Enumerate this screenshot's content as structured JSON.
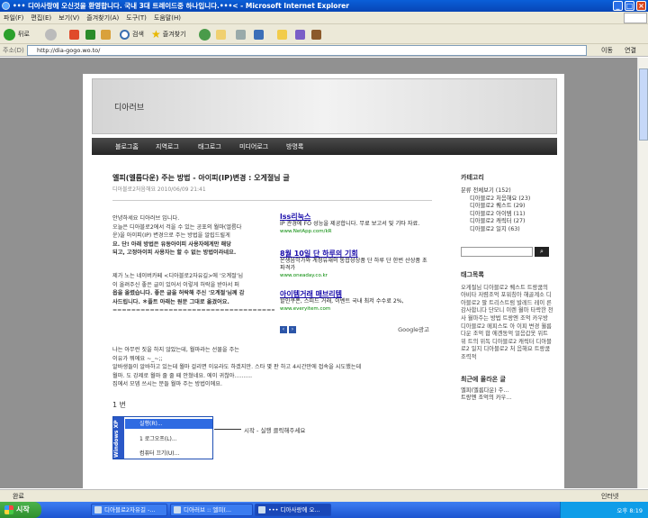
{
  "window": {
    "title": "••• 디아사랑에 오신것을 환영합니다. 국내 3대 트레이드중 하나입니다.•••< - Microsoft Internet Explorer",
    "controls": {
      "minimize": "_",
      "maximize": "□",
      "close": "×"
    }
  },
  "menu": [
    "파일(F)",
    "편집(E)",
    "보기(V)",
    "즐겨찾기(A)",
    "도구(T)",
    "도움말(H)"
  ],
  "toolbar": {
    "back": "뒤로",
    "search": "검색",
    "favorites": "즐겨찾기"
  },
  "address": {
    "label": "주소(D)",
    "url": "http://dia-gogo.wo.to/",
    "go": "이동",
    "links": "연결"
  },
  "blog": {
    "site_title": "디아러브",
    "nav": [
      "블로그홈",
      "지역로그",
      "태그로그",
      "미디어로그",
      "방명록"
    ],
    "post": {
      "title": "엘피(엘름다운) 주는 방법 - 아이피(IP)변경 : 오게절님 글",
      "meta": "디아블로2처음해요    2010/06/09 21:41",
      "intro": [
        "안녕하세요 디아러브 입니다.",
        "오늘은 디아블로2에서 걱을 수 있는 공포의 월마(엘름다",
        "운)을 아이피(IP) 변경으로 주는 방법을 알립드릴게",
        "요. 단! 아래 방법은 유동아이피 사용자에게만 해당",
        "되고, 고정아이피 사용자는 할 수 없는 방법이라네요."
      ],
      "intro2": [
        "제가 노는 네이버카페 <디아블로2자유길>에 '오계절'님",
        "이 올려주신 좋은 글이 있어서 이렇게 허락을 받아서 퍼",
        "옵을 올렸습니다. 좋은 글을 허락해 주신 '오계절'님께 감",
        "사드립니다. ＊플트 아래는 원문 그대로 옮겼어요.",
        "==========================================="
      ],
      "body": [
        "나는 아무런 짓을 하지 않았는데, 월마라는 선물을 주는",
        "이유가 뭐에요 ~_~;;",
        "알바생들이 알바하고 있는데 월마 걸리면 이유라도 하겠지만. 스타 몇 판 하고 4시간만에 접속을 시도했는데",
        "월마. 도 강제로 월마 줄 줄 떼 안쳤네요. 에이 귀찮아..........",
        "",
        "집에서 모뎀 쓰시는 분들 월마 주는 방법이에요."
      ],
      "step": "1 번",
      "start_menu": {
        "brand": "Windows XP",
        "items": [
          "실행(R)...",
          "1 로그오프(L)...",
          "컴퓨터 끄기(U)..."
        ]
      },
      "callout": "시작 - 실행 클릭해주세요"
    },
    "ads": [
      {
        "title": "lss리눅스",
        "desc": "IP 관경에 FO 성능을 제공합니다. 무료 보고서 및 기타 자료.",
        "url": "www.NetApp.com/kR"
      },
      {
        "title": "8월 10일 단 하루의 기회",
        "desc": "온생음악가와 계정유재의 통합성상품 단 하루 단 한번 산상품 초 파격가",
        "url": "www.oneaday.co.kr"
      },
      {
        "title": "아이템거래 매브리템",
        "desc": "할인쿠폰, 스피드 거래, 이벤트 국내 최저 수수료 2%,",
        "url": "www.everyitem.com"
      }
    ],
    "google_ad_label": "Google광고",
    "sidebar": {
      "category_heading": "카테고리",
      "category_root": "분류 전체보기 (152)",
      "categories": [
        "디아블로2 처음해요 (23)",
        "디아블로2 퀘스트 (29)",
        "디아블로2 아이템 (11)",
        "디아블로2 캐릭터 (27)",
        "디아블로2 일지 (63)"
      ],
      "search_button": "검색",
      "tag_heading": "태그목록",
      "tags": "오게절님  디아블로2 퀘스트  트랑쿰의 아비타  저렴조억 포워칭아 해골계소  디아블로2 팔  트리스트럼  발레드 레이 른 감사합니다  단모니 이렌 월마  타락한 천사  월마주는 방법  트랑엔 조억  카우방  디아블로2  메피스토  아 이피 변경  월름다운  조억 합 에겐동억  얼음갑옷  위트 위 트의 위독  디아블로2 캐릭터 디아블로2 일지  디아블로2 처 음해요  트랑쿰  조력적",
      "recent_heading": "최근에 올라온 글",
      "recent": [
        "엘피(엘름다운) 주...",
        "트랑엔 조억의 카우..."
      ]
    }
  },
  "statusbar": {
    "left": "완료",
    "right": "인터넷"
  },
  "taskbar": {
    "start": "시작",
    "tasks": [
      "디아블로2자유길 -...",
      "디아러브 :: 엘피(...",
      "••• 디아사랑에 오..."
    ],
    "clock": "오후 8:19"
  },
  "colors": {
    "titlebar": "#0745b6",
    "nav": "#262626",
    "link": "#1a0dab",
    "taskbar": "#245edb",
    "start": "#3a9a3a"
  }
}
